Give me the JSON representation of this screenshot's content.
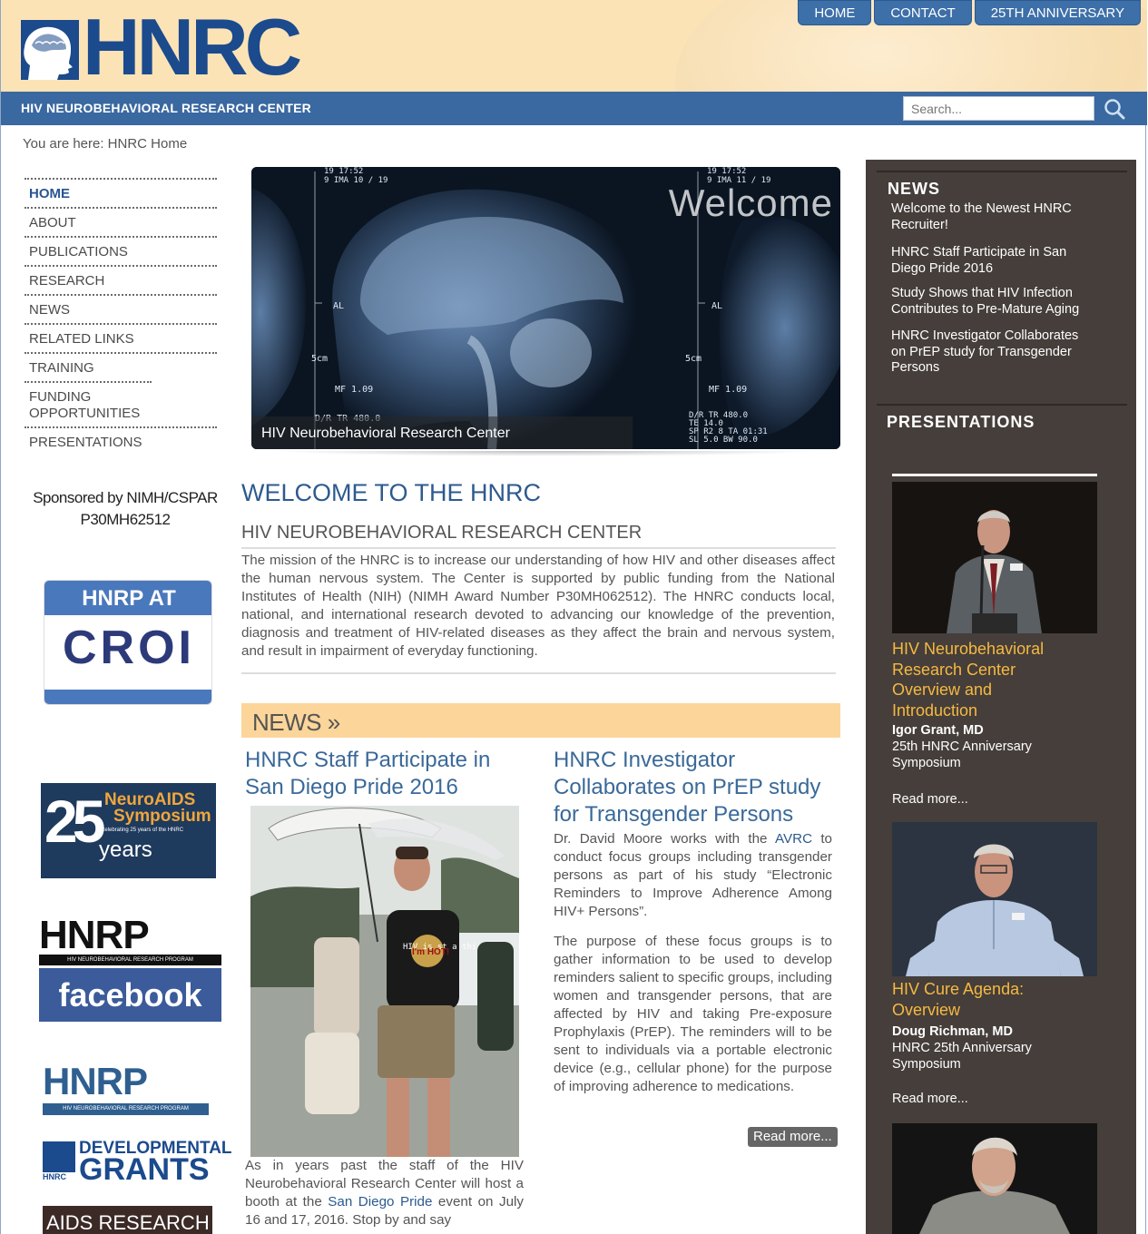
{
  "header": {
    "logo_text": "HNRC",
    "tagline": "HIV NEUROBEHAVIORAL RESEARCH CENTER",
    "nav": [
      "HOME",
      "CONTACT",
      "25TH ANNIVERSARY"
    ],
    "search_placeholder": "Search..."
  },
  "breadcrumb": "You are here: HNRC Home",
  "sidebar_nav": [
    "HOME",
    "ABOUT",
    "PUBLICATIONS",
    "RESEARCH",
    "NEWS",
    "RELATED LINKS",
    "TRAINING",
    "FUNDING OPPORTUNITIES",
    "PRESENTATIONS"
  ],
  "sponsor": {
    "line1": "Sponsored by NIMH/CSPAR",
    "line2": "P30MH62512"
  },
  "promos": {
    "croi_top": "HNRP AT",
    "croi_bottom": "CROI",
    "neuroaids_line1": "NeuroAIDS",
    "neuroaids_line2": "Symposium",
    "neuroaids_line3": "Celebrating 25 years of the HNRC",
    "neuroaids_num": "25",
    "neuroaids_years": "years",
    "hnrp": "HNRP",
    "hnrp_sub": "HIV NEUROBEHAVIORAL RESEARCH PROGRAM",
    "facebook": "facebook",
    "dev1": "DEVELOPMENTAL",
    "dev2": "GRANTS",
    "dev_small": "HNRC",
    "aids": "AIDS RESEARCH"
  },
  "hero": {
    "welcome": "Welcome",
    "caption": "HIV Neurobehavioral Research Center",
    "mri_left": "19 17:52\n9 IMA 10 / 19",
    "mri_right": "19 17:52\n9 IMA 11 / 19",
    "label_al": "AL",
    "label_5cm": "5cm",
    "label_mf": "MF 1.09",
    "label_dr": "D/R TR 480.0",
    "label_dr2": "D/R TR 480.0\nTE 14.0\nSP R2 8 TA 01:31\nSL 5.0 BW 90.0"
  },
  "main": {
    "title": "WELCOME TO THE HNRC",
    "subtitle": "HIV NEUROBEHAVIORAL RESEARCH CENTER",
    "mission": "The mission of the HNRC is to increase our understanding of how HIV and other diseases affect the human nervous system. The Center is supported by public funding from the National Institutes of Health (NIH) (NIMH Award Number P30MH062512). The HNRC conducts local, national, and international research devoted to advancing our knowledge of the prevention, diagnosis and treatment of HIV-related diseases as they affect the brain and nervous system, and result in impairment of everyday functioning.",
    "news_heading": "NEWS »"
  },
  "news_left": {
    "title": "HNRC Staff Participate in San Diego Pride 2016",
    "text_before": "As in years past the staff of the HIV Neurobehavioral Research Center will host a booth at the ",
    "link": "San Diego Pride",
    "text_after": " event on July 16 and 17, 2016.  Stop by and say",
    "shirt_text": "HIV is st a thi",
    "fan_text": "I'm HOT!"
  },
  "news_right": {
    "title": "HNRC Investigator Collaborates on PrEP study for Transgender Persons",
    "p1_before": "Dr. David Moore works with the ",
    "p1_link": "AVRC",
    "p1_after": " to conduct focus groups including transgender persons as part of his study “Electronic Reminders to Improve Adherence Among HIV+ Persons”.",
    "p2": "The purpose of these focus groups is to gather information to be used to develop reminders salient to specific groups, including women and transgender persons, that are affected by HIV and taking Pre-exposure Prophylaxis (PrEP). The reminders will to be sent to individuals via a portable electronic device (e.g., cellular phone) for the purpose of improving adherence to medications.",
    "read_more": "Read more..."
  },
  "right_sidebar": {
    "news_heading": "NEWS",
    "news_items": [
      "Welcome to the Newest HNRC Recruiter!",
      "HNRC Staff Participate in San Diego Pride 2016",
      "Study Shows that HIV Infection Contributes to Pre-Mature Aging",
      "HNRC Investigator Collaborates on PrEP study for Transgender Persons"
    ],
    "presentations_heading": "PRESENTATIONS",
    "presentations": [
      {
        "title": "HIV Neurobehavioral Research Center Overview and Introduction",
        "name": "Igor Grant, MD",
        "desc": "25th HNRC Anniversary Symposium",
        "more": "Read more..."
      },
      {
        "title": "HIV Cure Agenda: Overview",
        "name": "Doug Richman, MD",
        "desc": "HNRC 25th Anniversary Symposium",
        "more": "Read more..."
      }
    ]
  },
  "colors": {
    "brand_blue": "#1b4a8d",
    "header_bg": "#fce3b6",
    "sidebar_bg": "#453e3a",
    "accent_gold": "#f5b942"
  }
}
